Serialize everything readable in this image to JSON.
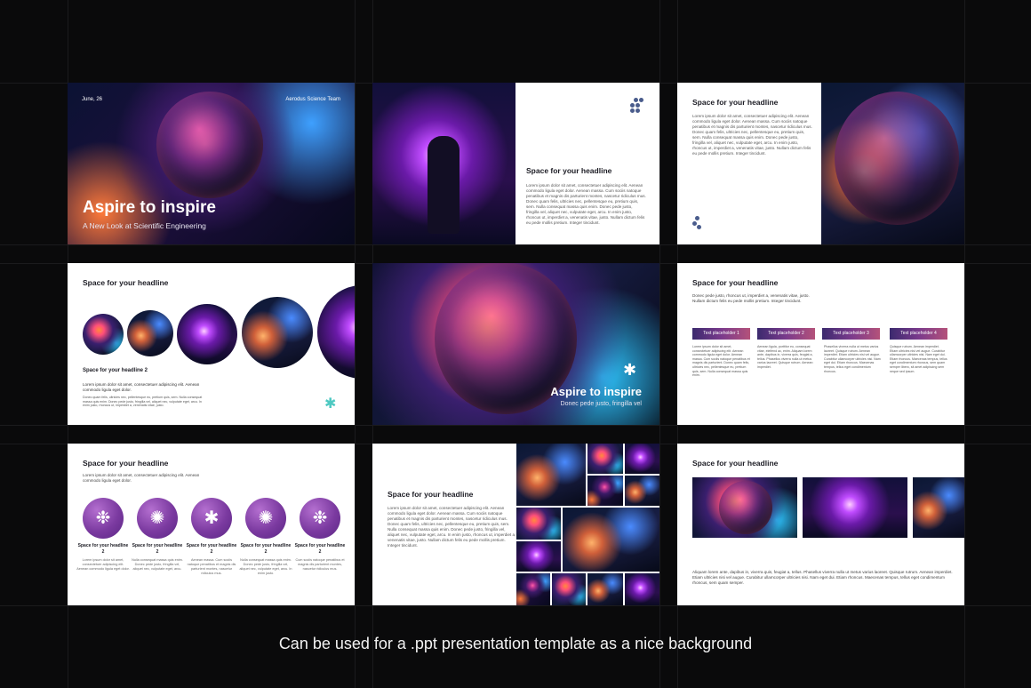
{
  "caption": "Can be used for a .ppt presentation template as a nice background",
  "colors": {
    "background": "#0a0a0b",
    "accent_purple": "#7b3aa0",
    "logo_blue": "#4a5c8c",
    "teal": "#4fc9c2"
  },
  "slide1": {
    "date": "June, 26",
    "team": "Aerodus Science Team",
    "title": "Aspire to inspire",
    "subtitle": "A New Look at Scientific Engineering"
  },
  "slide2": {
    "headline": "Space for your headline",
    "body": "Lorem ipsum dolor sit amet, consectetuer adipiscing elit. Aenean commodo ligula eget dolor. Aenean massa. Cum sociis natoque penatibus et magnis dis parturient montes, nascetur ridiculus mus. Donec quam felis, ultricies nec, pellentesque eu, pretium quis, sem. Nulla consequat massa quis enim. Donec pede justo, fringilla vel, aliquet nec, vulputate eget, arcu. In enim justo, rhoncus ut, imperdiet a, venenatis vitae, justo. Nullam dictum felis eu pede mollis pretium. Integer tincidunt."
  },
  "slide3": {
    "headline": "Space for your headline",
    "body": "Lorem ipsum dolor sit amet, consectetuer adipiscing elit. Aenean commodo ligula eget dolor. Aenean massa. Cum sociis natoque penatibus et magnis dis parturient montes, nascetur ridiculus mus. Donec quam felis, ultricies nec, pellentesque eu, pretium quis, sem. Nulla consequat massa quis enim. Donec pede justo, fringilla vel, aliquet nec, vulputate eget, arcu. In enim justo, rhoncus ut, imperdiet a, venenatis vitae, justo. Nullam dictum felis eu pede mollis pretium. Integer tincidunt."
  },
  "slide4": {
    "headline": "Space for your headline",
    "headline2": "Space for your headline 2",
    "body1": "Lorem ipsum dolor sit amet, consectetuer adipiscing elit. Aenean commodo ligula eget dolor.",
    "body2": "Donec quam felis, ultricies nec, pellentesque eu, pretium quis, sem. Nulla consequat massa quis enim. Donec pede justo, fringilla vel, aliquet nec, vulputate eget, arcu. In enim justo, rhoncus ut, imperdiet a, venenatis vitae, justo."
  },
  "slide5": {
    "title": "Aspire to inspire",
    "subtitle": "Donec pede justo, fringilla vel"
  },
  "slide6": {
    "headline": "Space for your headline",
    "intro": "Donec pede justo, rhoncus ut, imperdiet a, venenatis vitae, justo. Nullam dictum felis eu pede mollis pretium. Integer tincidunt.",
    "placeholders": [
      {
        "label": "Text placeholder 1",
        "body": "Lorem ipsum dolor sit amet, consectetuer adipiscing elit. Aenean commodo ligula eget dolor. Aenean massa. Cum sociis natoque penatibus et magnis dis parturient. Donec quam felis, ultricies nec, pellentesque eu, pretium quis, sem. Nulla consequat massa quis enim."
      },
      {
        "label": "Text placeholder 2",
        "body": "Aenean ligula, porttitor eu, consequat vitae, eleifend ac, enim. Aliquam lorem ante, dapibus in, viverra quis, feugiat a, tellus. Phasellus viverra nulla ut metus varius laoreet. Quisque rutrum. Aenean imperdiet."
      },
      {
        "label": "Text placeholder 3",
        "body": "Phasellus viverra nulla ut metus varius laoreet. Quisque rutrum. Aenean imperdiet. Etiam ultricies nisi vel augue. Curabitur ullamcorper ultricies nisi. Nam eget dui. Etiam rhoncus. Maecenas tempus, tellus eget condimentum rhoncus."
      },
      {
        "label": "Text placeholder 4",
        "body": "Quisque rutrum. Aenean imperdiet. Etiam ultricies nisi vel augue. Curabitur ullamcorper ultricies nisi. Nam eget dui. Etiam rhoncus. Maecenas tempus, tellus eget condimentum rhoncus, sem quam semper libero, sit amet adipiscing sem neque sed ipsum."
      }
    ]
  },
  "slide7": {
    "headline": "Space for your headline",
    "intro": "Lorem ipsum dolor sit amet, consectetuer adipiscing elit. Aenean commodo ligula eget dolor.",
    "items": [
      {
        "title": "Space for your headline 2",
        "body": "Lorem ipsum dolor sit amet, consectetuer adipiscing elit. Aenean commodo ligula eget dolor."
      },
      {
        "title": "Space for your headline 2",
        "body": "Nulla consequat massa quis enim. Donec pede justo, fringilla vel, aliquet nec, vulputate eget, arcu."
      },
      {
        "title": "Space for your headline 2",
        "body": "Aenean massa. Cum sociis natoque penatibus et magnis dis parturient montes, nascetur ridiculus mus."
      },
      {
        "title": "Space for your headline 2",
        "body": "Nulla consequat massa quis enim. Donec pede justo, fringilla vel, aliquet nec, vulputate eget, arcu. In enim justo."
      },
      {
        "title": "Space for your headline 2",
        "body": "Cum sociis natoque penatibus et magnis dis parturient montes, nascetur ridiculus mus."
      }
    ]
  },
  "slide8": {
    "headline": "Space for your headline",
    "body": "Lorem ipsum dolor sit amet, consectetuer adipiscing elit. Aenean commodo ligula eget dolor. Aenean massa. Cum sociis natoque penatibus et magnis dis parturient montes, nascetur ridiculus mus. Donec quam felis, ultricies nec, pellentesque eu, pretium quis, sem. Nulla consequat massa quis enim. Donec pede justo, fringilla vel, aliquet nec, vulputate eget, arcu. In enim justo, rhoncus ut, imperdiet a, venenatis vitae, justo. Nullam dictum felis eu pede mollis pretium. Integer tincidunt."
  },
  "slide9": {
    "headline": "Space for your headline",
    "body": "Aliquam lorem ante, dapibus in, viverra quis, feugiat a, tellus. Phasellus viverra nulla ut metus varius laoreet. Quisque rutrum. Aenean imperdiet. Etiam ultricies nisi vel augue. Curabitur ullamcorper ultricies nisi. Nam eget dui. Etiam rhoncus. Maecenas tempus, tellus eget condimentum rhoncus, sem quam semper."
  }
}
